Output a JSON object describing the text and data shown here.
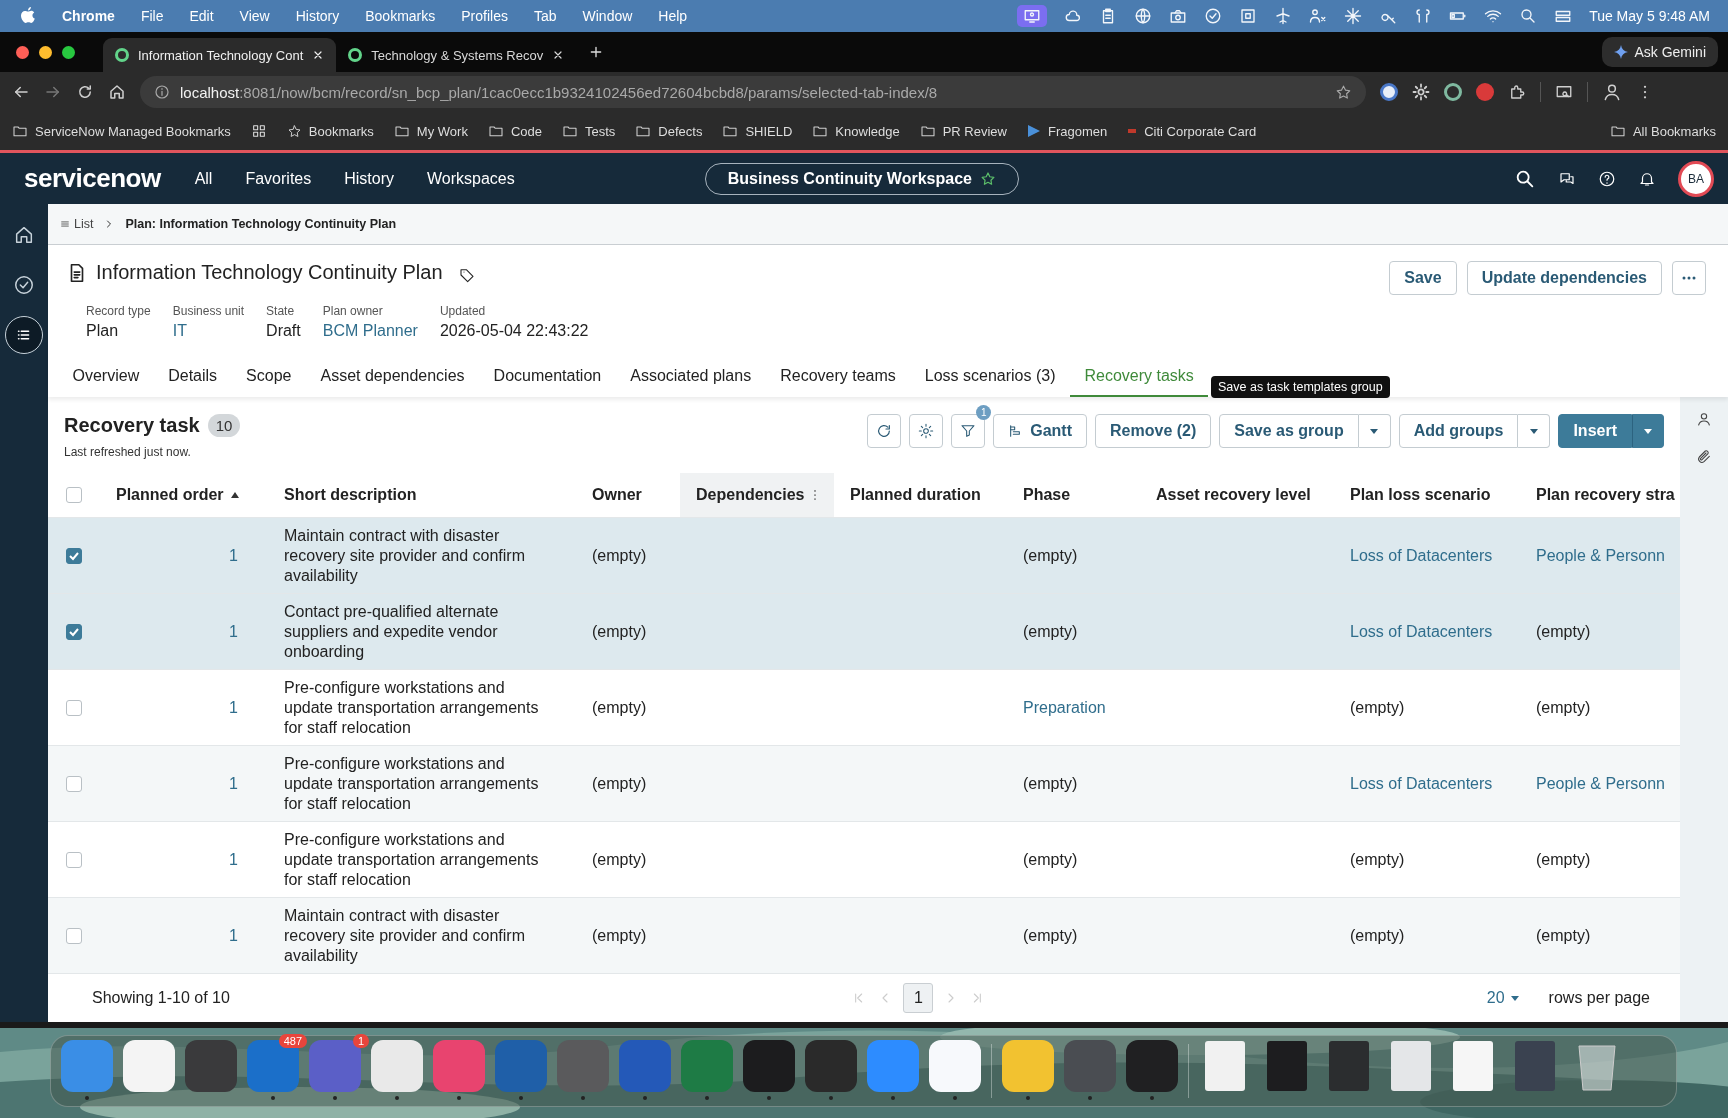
{
  "menubar": {
    "app": "Chrome",
    "menus": [
      "File",
      "Edit",
      "View",
      "History",
      "Bookmarks",
      "Profiles",
      "Tab",
      "Window",
      "Help"
    ],
    "clock": "Tue May 5  9:48 AM"
  },
  "browser": {
    "tabs": [
      {
        "title": "Information Technology Cont",
        "selected": true
      },
      {
        "title": "Technology & Systems Recov",
        "selected": false
      }
    ],
    "ask_button": "Ask Gemini",
    "url": {
      "host": "localhost",
      "path": ":8081/now/bcm/record/sn_bcp_plan/1cac0ecc1b9324102456ed72604bcbd8/params/selected-tab-index/8"
    },
    "bookmarks": [
      {
        "kind": "managed",
        "label": "ServiceNow Managed Bookmarks"
      },
      {
        "kind": "apps"
      },
      {
        "kind": "star",
        "label": "Bookmarks"
      },
      {
        "kind": "folder",
        "label": "My Work"
      },
      {
        "kind": "folder",
        "label": "Code"
      },
      {
        "kind": "folder",
        "label": "Tests"
      },
      {
        "kind": "folder",
        "label": "Defects"
      },
      {
        "kind": "folder",
        "label": "SHIELD"
      },
      {
        "kind": "folder",
        "label": "Knowledge"
      },
      {
        "kind": "folder",
        "label": "PR Review"
      },
      {
        "kind": "link",
        "label": "Fragomen"
      },
      {
        "kind": "card",
        "label": "Citi Corporate Card"
      }
    ],
    "all_bookmarks": "All Bookmarks"
  },
  "app_header": {
    "logo": "servicenow",
    "nav": [
      "All",
      "Favorites",
      "History",
      "Workspaces"
    ],
    "workspace": "Business Continuity Workspace",
    "avatar": "BA"
  },
  "sidebar": {
    "items": [
      {
        "kind": "home",
        "selected": false
      },
      {
        "kind": "check",
        "selected": false
      },
      {
        "kind": "list",
        "selected": true
      }
    ]
  },
  "breadcrumb": {
    "list": "List",
    "current": "Plan: Information Technology Continuity Plan"
  },
  "record": {
    "title": "Information Technology Continuity Plan",
    "actions": [
      "Save",
      "Update dependencies"
    ],
    "fields": [
      {
        "label": "Record type",
        "value": "Plan",
        "link": false
      },
      {
        "label": "Business unit",
        "value": "IT",
        "link": true
      },
      {
        "label": "State",
        "value": "Draft",
        "link": false
      },
      {
        "label": "Plan owner",
        "value": "BCM Planner",
        "link": true
      },
      {
        "label": "Updated",
        "value": "2026-05-04 22:43:22",
        "link": false
      }
    ]
  },
  "tabs": [
    {
      "label": "Overview",
      "selected": false
    },
    {
      "label": "Details",
      "selected": false
    },
    {
      "label": "Scope",
      "selected": false
    },
    {
      "label": "Asset dependencies",
      "selected": false
    },
    {
      "label": "Documentation",
      "selected": false
    },
    {
      "label": "Associated plans",
      "selected": false
    },
    {
      "label": "Recovery teams",
      "selected": false
    },
    {
      "label": "Loss scenarios (3)",
      "selected": false
    },
    {
      "label": "Recovery tasks",
      "selected": true
    }
  ],
  "tooltip": "Save as task templates group",
  "related_list": {
    "title": "Recovery task",
    "count": "10",
    "refreshed": "Last refreshed just now.",
    "filter_count": "1",
    "buttons": {
      "gantt": "Gantt",
      "remove": "Remove (2)",
      "save_group": "Save as group",
      "add_groups": "Add groups",
      "insert": "Insert"
    },
    "select_all": {
      "checked": false
    },
    "columns": [
      {
        "label": "Planned order",
        "sorted": true,
        "highlighted": false
      },
      {
        "label": "Short description",
        "sorted": false,
        "highlighted": false
      },
      {
        "label": "Owner",
        "sorted": false,
        "highlighted": false
      },
      {
        "label": "Dependencies",
        "sorted": false,
        "highlighted": true
      },
      {
        "label": "Planned duration",
        "sorted": false,
        "highlighted": false
      },
      {
        "label": "Phase",
        "sorted": false,
        "highlighted": false
      },
      {
        "label": "Asset recovery level",
        "sorted": false,
        "highlighted": false
      },
      {
        "label": "Plan loss scenario",
        "sorted": false,
        "highlighted": false
      },
      {
        "label": "Plan recovery stra",
        "sorted": false,
        "highlighted": false
      }
    ],
    "rows": [
      {
        "selected": true,
        "planned_order": "1",
        "short_description": "Maintain contract with disaster recovery site provider and confirm availability",
        "owner": "(empty)",
        "phase": {
          "text": "(empty)",
          "link": false
        },
        "plan_loss_scenario": {
          "text": "Loss of Datacenters",
          "link": true
        },
        "plan_recovery_strategy": {
          "text": "People & Personn",
          "link": true
        }
      },
      {
        "selected": true,
        "planned_order": "1",
        "short_description": "Contact pre-qualified alternate suppliers and expedite vendor onboarding",
        "owner": "(empty)",
        "phase": {
          "text": "(empty)",
          "link": false
        },
        "plan_loss_scenario": {
          "text": "Loss of Datacenters",
          "link": true
        },
        "plan_recovery_strategy": {
          "text": "(empty)",
          "link": false
        }
      },
      {
        "selected": false,
        "planned_order": "1",
        "short_description": "Pre-configure workstations and update transportation arrangements for staff relocation",
        "owner": "(empty)",
        "phase": {
          "text": "Preparation",
          "link": true
        },
        "plan_loss_scenario": {
          "text": "(empty)",
          "link": false
        },
        "plan_recovery_strategy": {
          "text": "(empty)",
          "link": false
        }
      },
      {
        "selected": false,
        "planned_order": "1",
        "short_description": "Pre-configure workstations and update transportation arrangements for staff relocation",
        "owner": "(empty)",
        "phase": {
          "text": "(empty)",
          "link": false
        },
        "plan_loss_scenario": {
          "text": "Loss of Datacenters",
          "link": true
        },
        "plan_recovery_strategy": {
          "text": "People & Personn",
          "link": true
        }
      },
      {
        "selected": false,
        "planned_order": "1",
        "short_description": "Pre-configure workstations and update transportation arrangements for staff relocation",
        "owner": "(empty)",
        "phase": {
          "text": "(empty)",
          "link": false
        },
        "plan_loss_scenario": {
          "text": "(empty)",
          "link": false
        },
        "plan_recovery_strategy": {
          "text": "(empty)",
          "link": false
        }
      },
      {
        "selected": false,
        "planned_order": "1",
        "short_description": "Maintain contract with disaster recovery site provider and confirm availability",
        "owner": "(empty)",
        "phase": {
          "text": "(empty)",
          "link": false
        },
        "plan_loss_scenario": {
          "text": "(empty)",
          "link": false
        },
        "plan_recovery_strategy": {
          "text": "(empty)",
          "link": false
        }
      }
    ],
    "footer": {
      "showing": "Showing 1-10 of 10",
      "pages": [
        {
          "label": "1",
          "selected": true
        }
      ],
      "page_size": "20",
      "page_size_label": "rows per page"
    }
  },
  "dock": [
    {
      "kind": "app",
      "color": "#3a8ee6",
      "running": true
    },
    {
      "kind": "app",
      "color": "#f4f4f4",
      "running": false
    },
    {
      "kind": "app",
      "color": "#3a3a3c",
      "running": false
    },
    {
      "kind": "app",
      "color": "#1b6fc9",
      "running": true,
      "badge": "487"
    },
    {
      "kind": "app",
      "color": "#5b5fc7",
      "running": true,
      "badge": "1"
    },
    {
      "kind": "app",
      "color": "#e9e9e9",
      "running": true
    },
    {
      "kind": "app",
      "color": "#e8446f",
      "running": true
    },
    {
      "kind": "app",
      "color": "#1f5fa8",
      "running": true
    },
    {
      "kind": "app",
      "color": "#5a5a5c",
      "running": true
    },
    {
      "kind": "app",
      "color": "#2459b8",
      "running": true
    },
    {
      "kind": "app",
      "color": "#1e7b45",
      "running": true
    },
    {
      "kind": "app",
      "color": "#1c1c1e",
      "running": true
    },
    {
      "kind": "app",
      "color": "#2a2a2a",
      "running": true
    },
    {
      "kind": "app",
      "color": "#2d8cff",
      "running": true
    },
    {
      "kind": "app",
      "color": "#f7f9fc",
      "running": true
    },
    {
      "kind": "separator"
    },
    {
      "kind": "app",
      "color": "#f2c230",
      "running": true
    },
    {
      "kind": "app",
      "color": "#4a4d52",
      "running": true
    },
    {
      "kind": "app",
      "color": "#202022",
      "running": true
    },
    {
      "kind": "separator"
    },
    {
      "kind": "thumbnail",
      "color": "#f1f1f1",
      "running": false
    },
    {
      "kind": "thumbnail",
      "color": "#1d1d1f",
      "running": false
    },
    {
      "kind": "thumbnail",
      "color": "#2b2d2f",
      "running": false
    },
    {
      "kind": "thumbnail",
      "color": "#e4e6e8",
      "running": false
    },
    {
      "kind": "thumbnail",
      "color": "#f6f6f6",
      "running": false
    },
    {
      "kind": "thumbnail",
      "color": "#3a4250",
      "running": false
    },
    {
      "kind": "trash",
      "running": false
    }
  ]
}
